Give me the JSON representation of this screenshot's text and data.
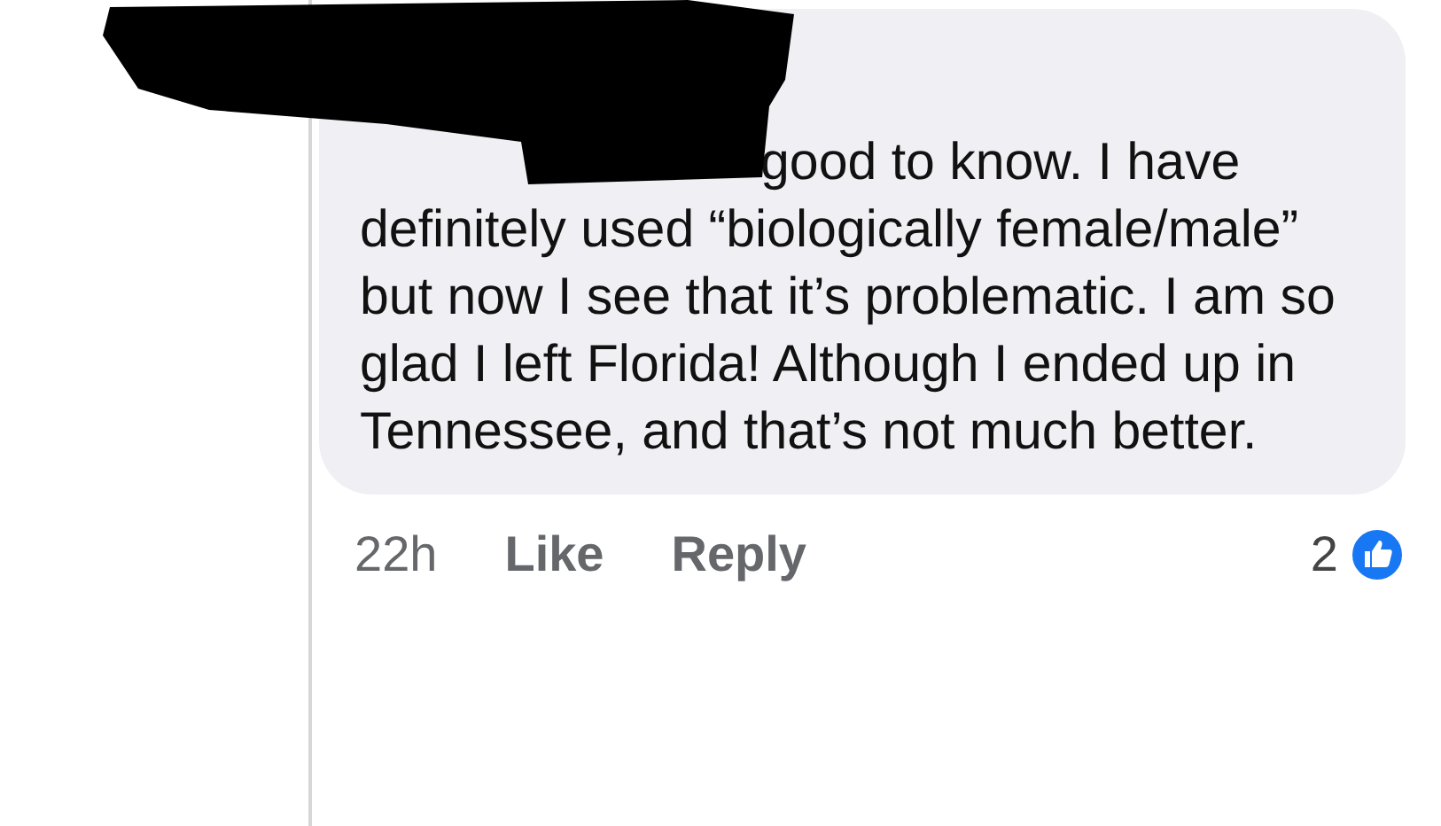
{
  "comment": {
    "text": "good to know. I have definitely used “biologically female/male” but now I see that it’s problematic. I am so glad I left Florida! Although I ended up in Tennessee, and that’s not much better.",
    "redacted": true,
    "time": "22h",
    "actions": [
      "Like",
      "Reply"
    ],
    "reaction_count": "2"
  }
}
